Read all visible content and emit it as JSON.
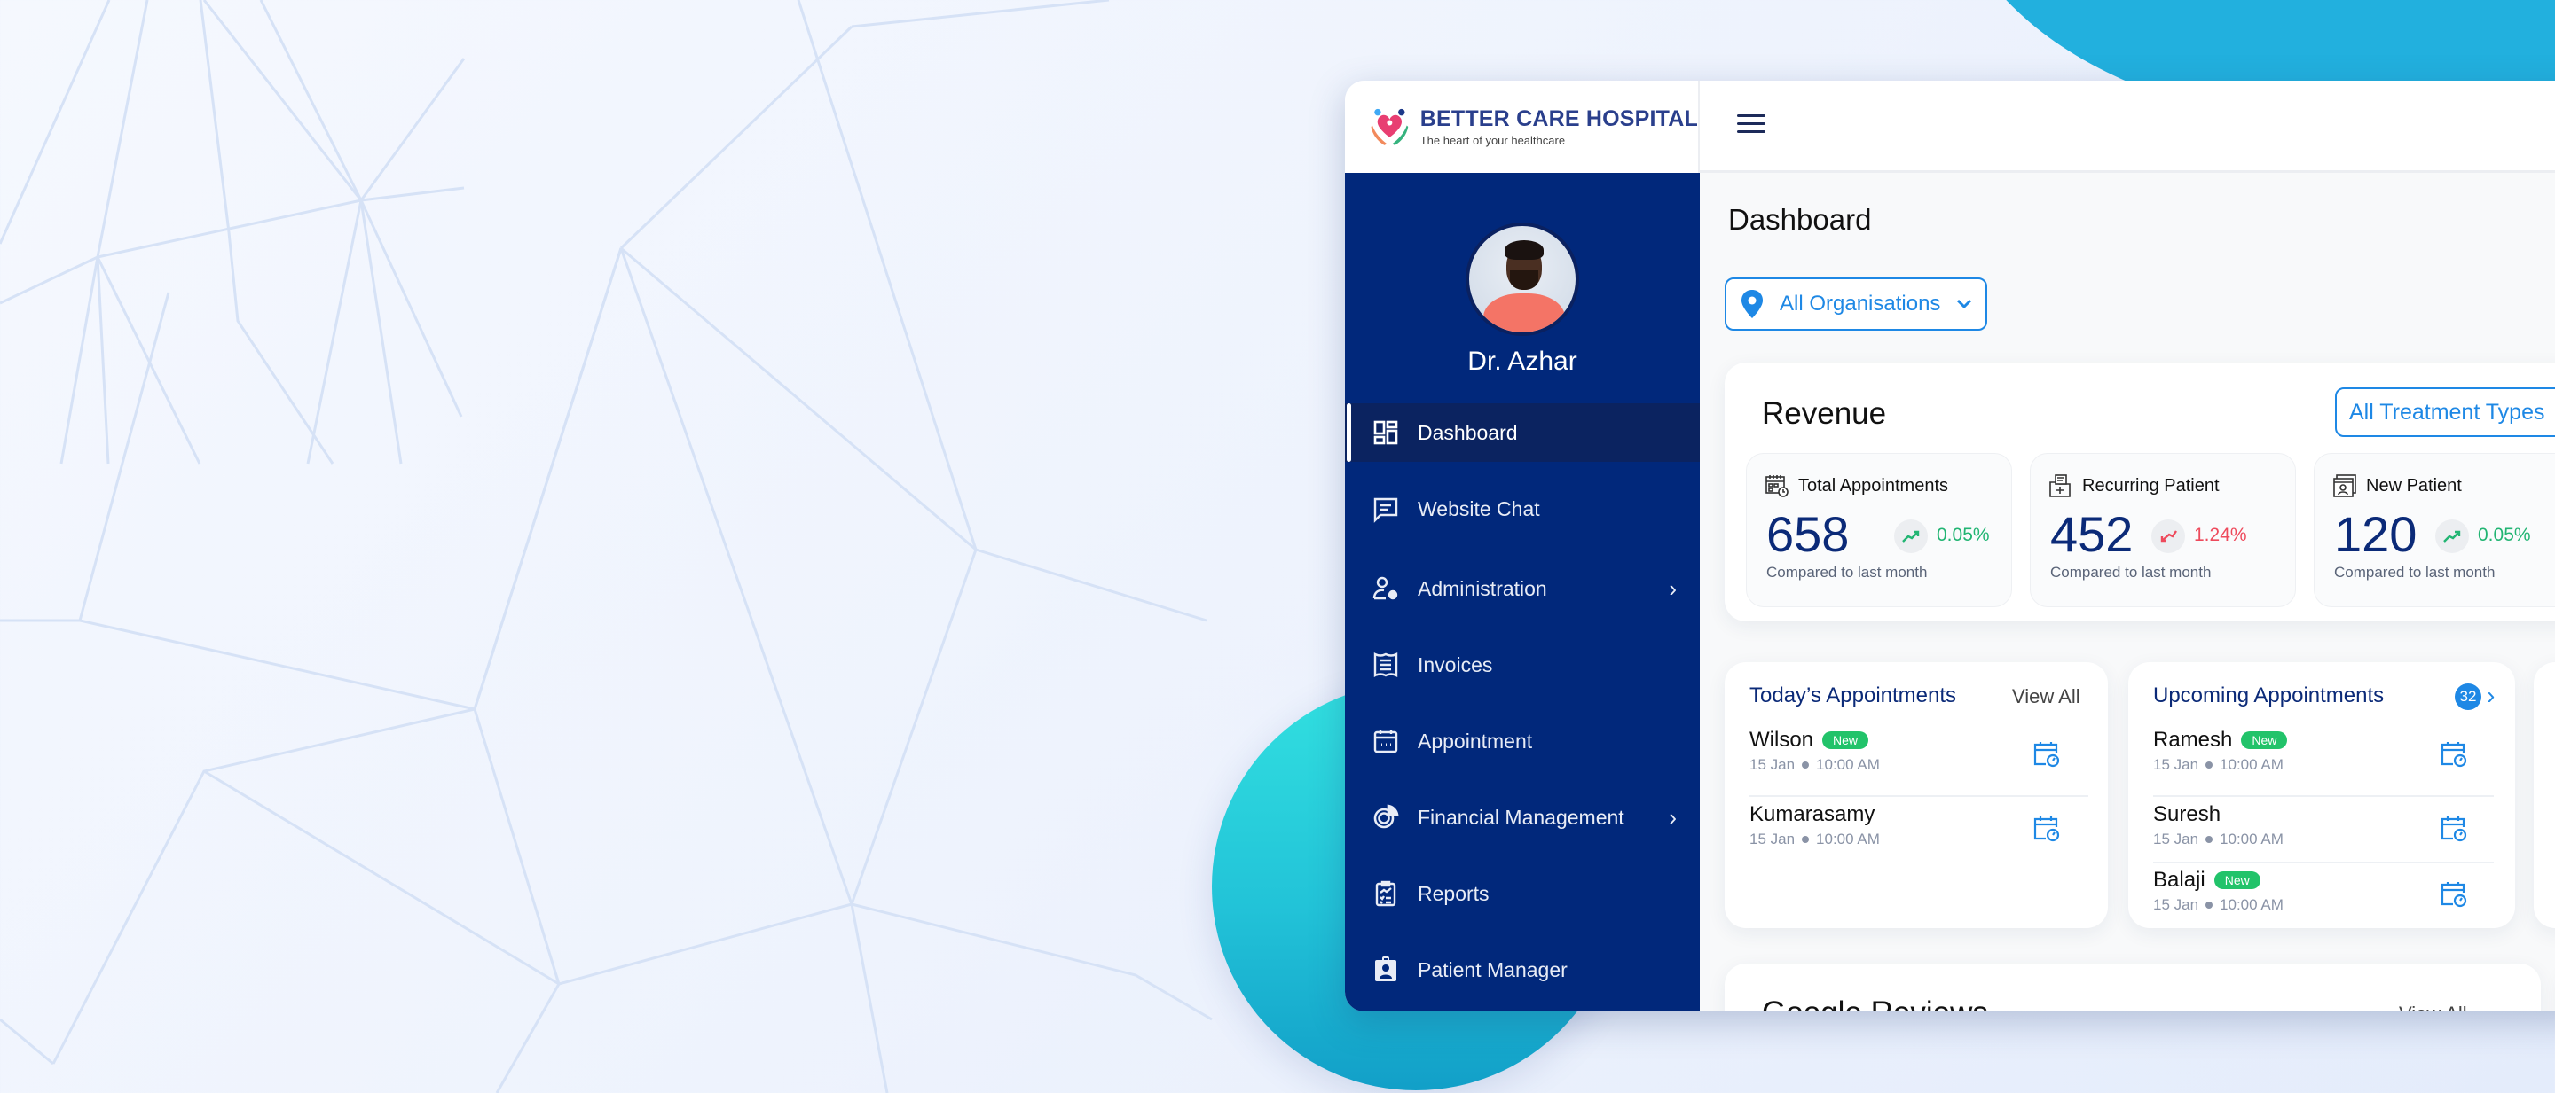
{
  "brand": {
    "name": "BETTER CARE HOSPITAL",
    "tagline": "The heart of your healthcare"
  },
  "user": {
    "name": "Dr. Azhar"
  },
  "sidebar": {
    "items": [
      {
        "label": "Dashboard",
        "icon": "dashboard-grid-icon",
        "active": true,
        "has_submenu": false
      },
      {
        "label": "Website Chat",
        "icon": "chat-icon",
        "active": false,
        "has_submenu": false
      },
      {
        "label": "Administration",
        "icon": "user-gear-icon",
        "active": false,
        "has_submenu": true
      },
      {
        "label": "Invoices",
        "icon": "receipt-icon",
        "active": false,
        "has_submenu": false
      },
      {
        "label": "Appointment",
        "icon": "calendar-icon",
        "active": false,
        "has_submenu": false
      },
      {
        "label": "Financial Management",
        "icon": "finance-chart-icon",
        "active": false,
        "has_submenu": true
      },
      {
        "label": "Reports",
        "icon": "clipboard-report-icon",
        "active": false,
        "has_submenu": false
      },
      {
        "label": "Patient Manager",
        "icon": "id-badge-icon",
        "active": false,
        "has_submenu": false
      }
    ]
  },
  "main": {
    "title": "Dashboard",
    "org_filter": {
      "selected": "All Organisations"
    },
    "revenue": {
      "title": "Revenue",
      "treatment_filter": {
        "selected": "All Treatment Types"
      },
      "stats": [
        {
          "label": "Total Appointments",
          "value": "658",
          "change": "0.05%",
          "direction": "up",
          "compare": "Compared to last month"
        },
        {
          "label": "Recurring Patient",
          "value": "452",
          "change": "1.24%",
          "direction": "down",
          "compare": "Compared to last month"
        },
        {
          "label": "New Patient",
          "value": "120",
          "change": "0.05%",
          "direction": "up",
          "compare": "Compared to last month"
        }
      ]
    },
    "todays_appointments": {
      "title": "Today’s Appointments",
      "view_all": "View All",
      "items": [
        {
          "name": "Wilson",
          "badge": "New",
          "date": "15 Jan",
          "time": "10:00 AM"
        },
        {
          "name": "Kumarasamy",
          "badge": "",
          "date": "15 Jan",
          "time": "10:00 AM"
        }
      ]
    },
    "upcoming_appointments": {
      "title": "Upcoming Appointments",
      "count": "32",
      "items": [
        {
          "name": "Ramesh",
          "badge": "New",
          "date": "15 Jan",
          "time": "10:00 AM"
        },
        {
          "name": "Suresh",
          "badge": "",
          "date": "15 Jan",
          "time": "10:00 AM"
        },
        {
          "name": "Balaji",
          "badge": "New",
          "date": "15 Jan",
          "time": "10:00 AM"
        }
      ]
    },
    "google_reviews": {
      "title": "Google Reviews",
      "view_all": "View All"
    }
  },
  "colors": {
    "sidebar_bg": "#01287b",
    "accent_blue": "#1e88e5",
    "positive": "#22b573",
    "negative": "#ee4a5c",
    "badge_new": "#22c36a"
  }
}
